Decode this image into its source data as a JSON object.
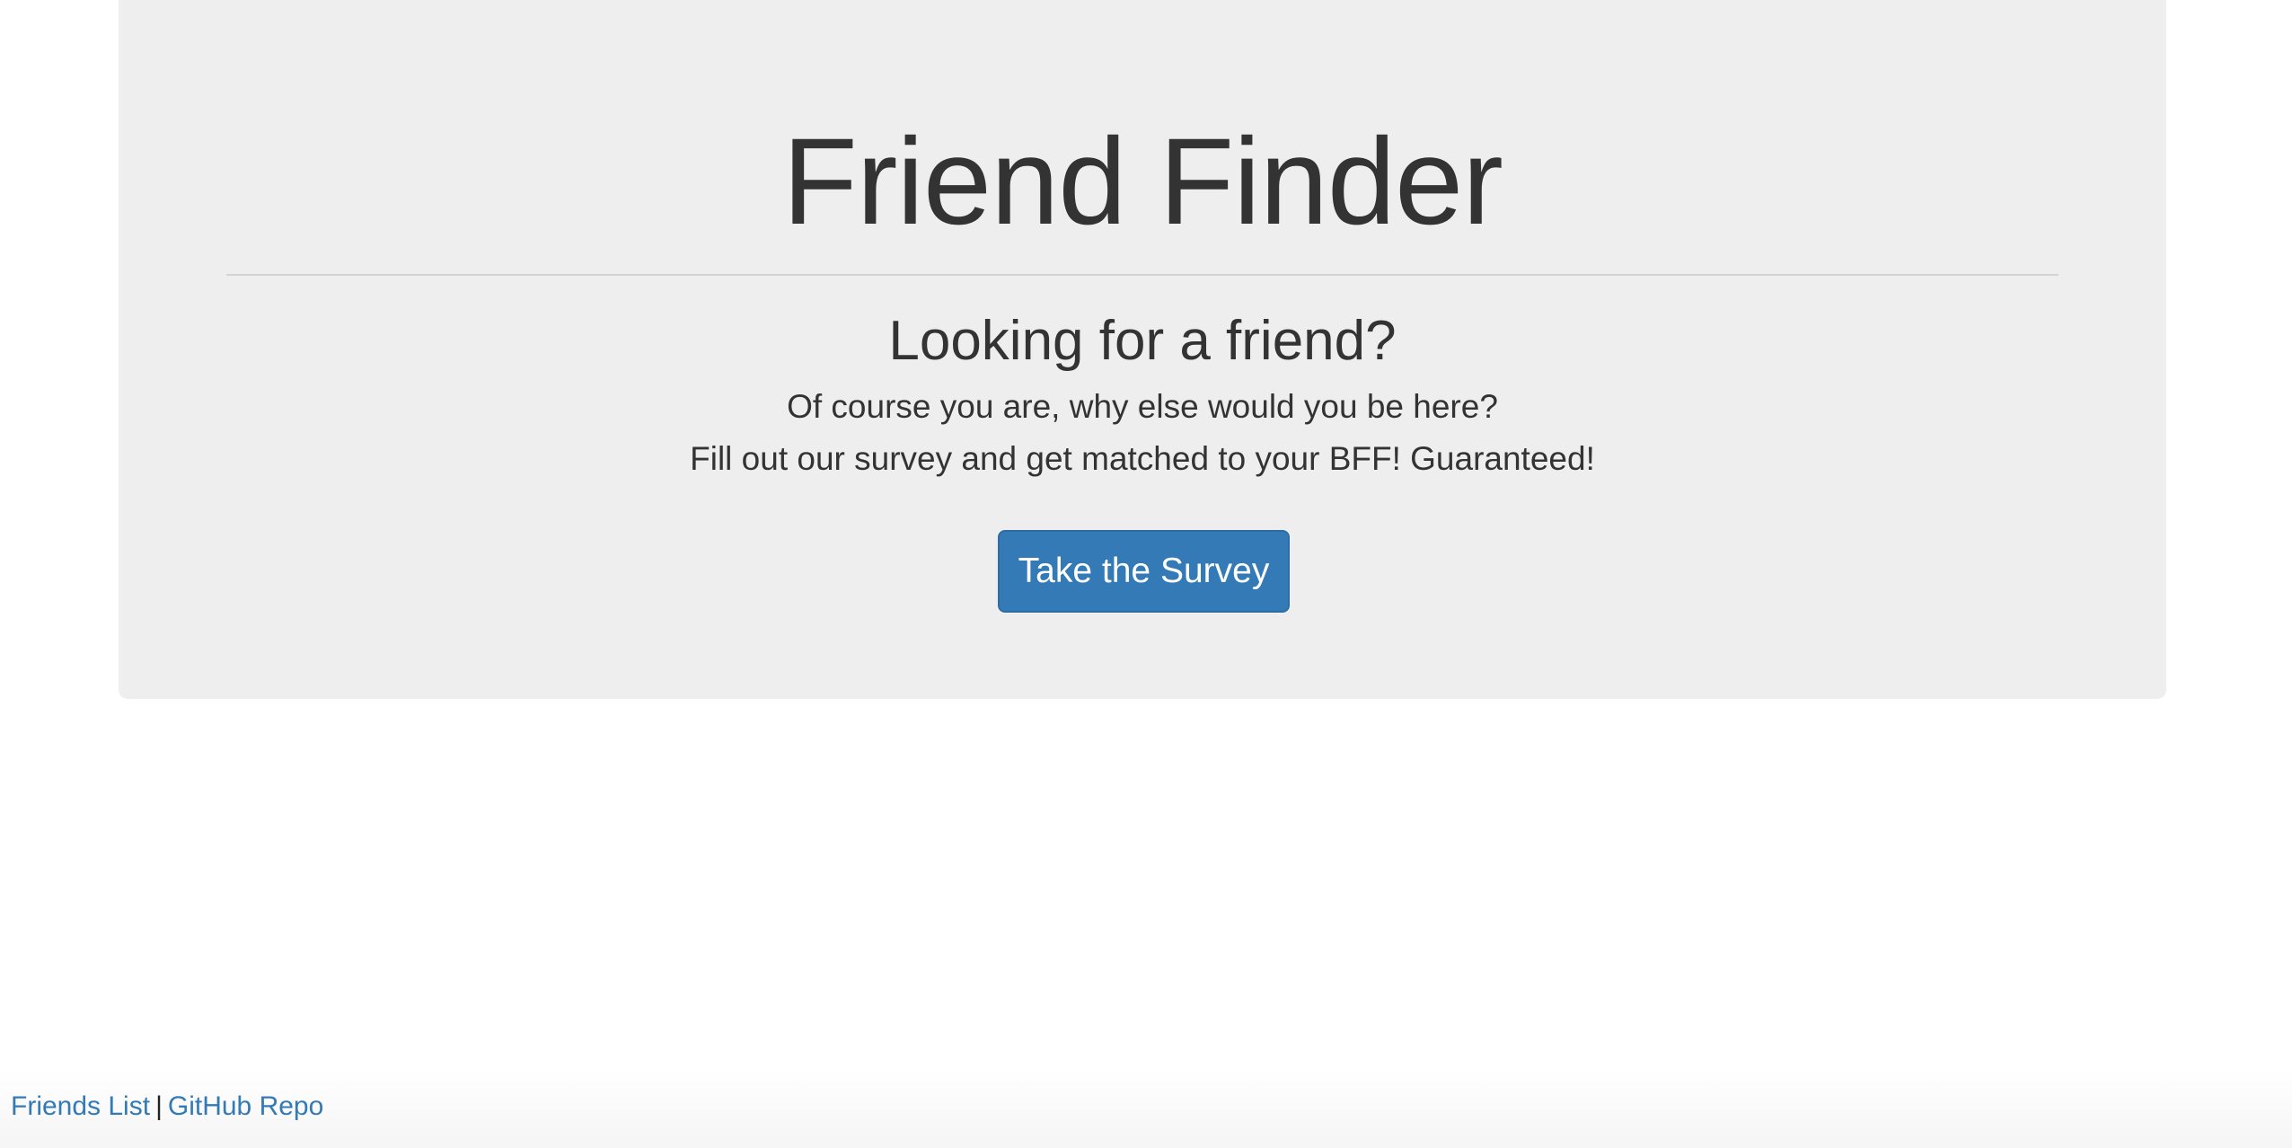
{
  "jumbotron": {
    "title": "Friend Finder",
    "subtitle": "Looking for a friend?",
    "line1": "Of course you are, why else would you be here?",
    "line2": "Fill out our survey and get matched to your BFF! Guaranteed!",
    "button_label": "Take the Survey"
  },
  "footer": {
    "friends_list": "Friends List",
    "separator": "|",
    "github_repo": "GitHub Repo"
  },
  "colors": {
    "jumbotron_bg": "#eeeeee",
    "primary_button": "#337ab7",
    "link": "#337ab7",
    "text": "#333333"
  }
}
